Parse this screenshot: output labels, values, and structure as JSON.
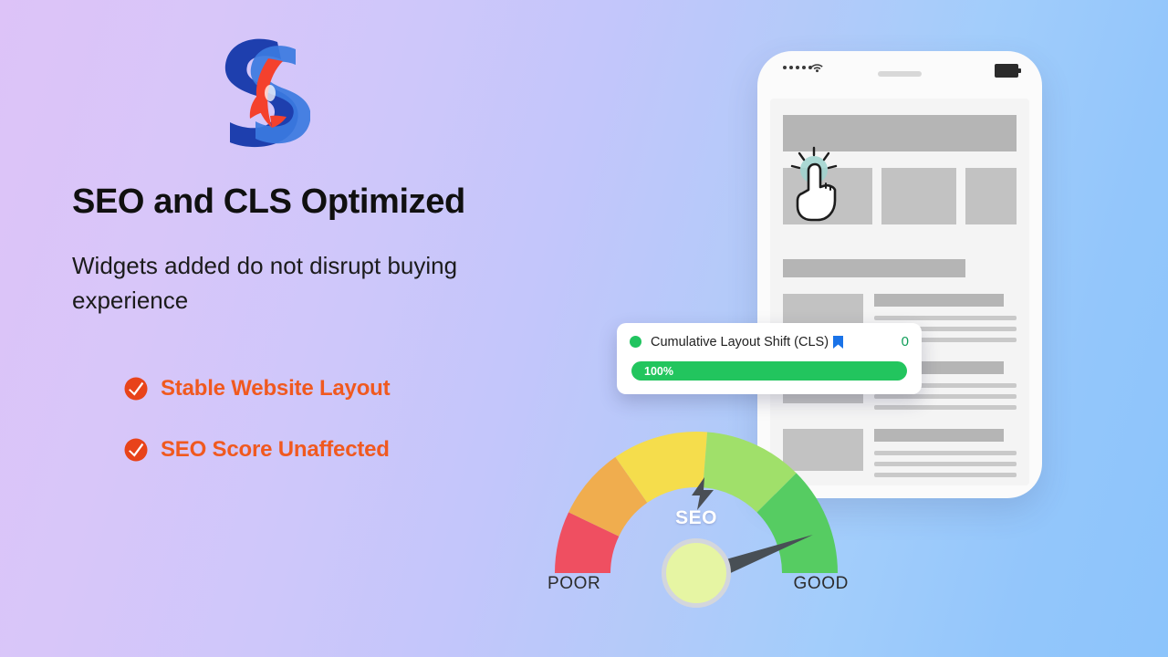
{
  "theme": {
    "bg_start": "#ddc3f8",
    "bg_end": "#8cc4fb",
    "accent_orange": "#f0591f",
    "accent_green": "#22c55e",
    "accent_blue": "#1a73e8"
  },
  "logo": {
    "name": "overlapping-s-logo",
    "dark_blue": "#1e3fae",
    "light_blue": "#3b7ae0",
    "red": "#f4412d"
  },
  "content": {
    "headline": "SEO and CLS Optimized",
    "subhead": "Widgets added do not disrupt buying experience",
    "bullets": [
      {
        "icon": "check-circle-icon",
        "label": "Stable Website Layout"
      },
      {
        "icon": "check-circle-icon",
        "label": "SEO Score Unaffected"
      }
    ]
  },
  "phone": {
    "status_bar": {
      "signal_icon": "signal-dots-icon",
      "signal_dots": 5,
      "wifi_icon": "wifi-icon",
      "battery_icon": "battery-icon",
      "speaker_icon": "speaker-notch"
    },
    "cursor_icon": "hand-pointer-tap-icon"
  },
  "cls_card": {
    "status_dot": "status-dot-green",
    "label": "Cumulative Layout Shift (CLS)",
    "flag_icon": "bookmark-flag-icon",
    "value": "0",
    "progress_label": "100%",
    "progress_percent": 100
  },
  "gauge": {
    "bolt_icon": "lightning-bolt-icon",
    "center_label": "SEO",
    "min_label": "POOR",
    "max_label": "GOOD",
    "needle_position": "good",
    "segments": [
      {
        "name": "poor",
        "color": "#ef4f61"
      },
      {
        "name": "fair",
        "color": "#f0ad4e"
      },
      {
        "name": "average",
        "color": "#f5dd4c"
      },
      {
        "name": "good",
        "color": "#a0e06a"
      },
      {
        "name": "excellent",
        "color": "#56cc62"
      }
    ]
  }
}
